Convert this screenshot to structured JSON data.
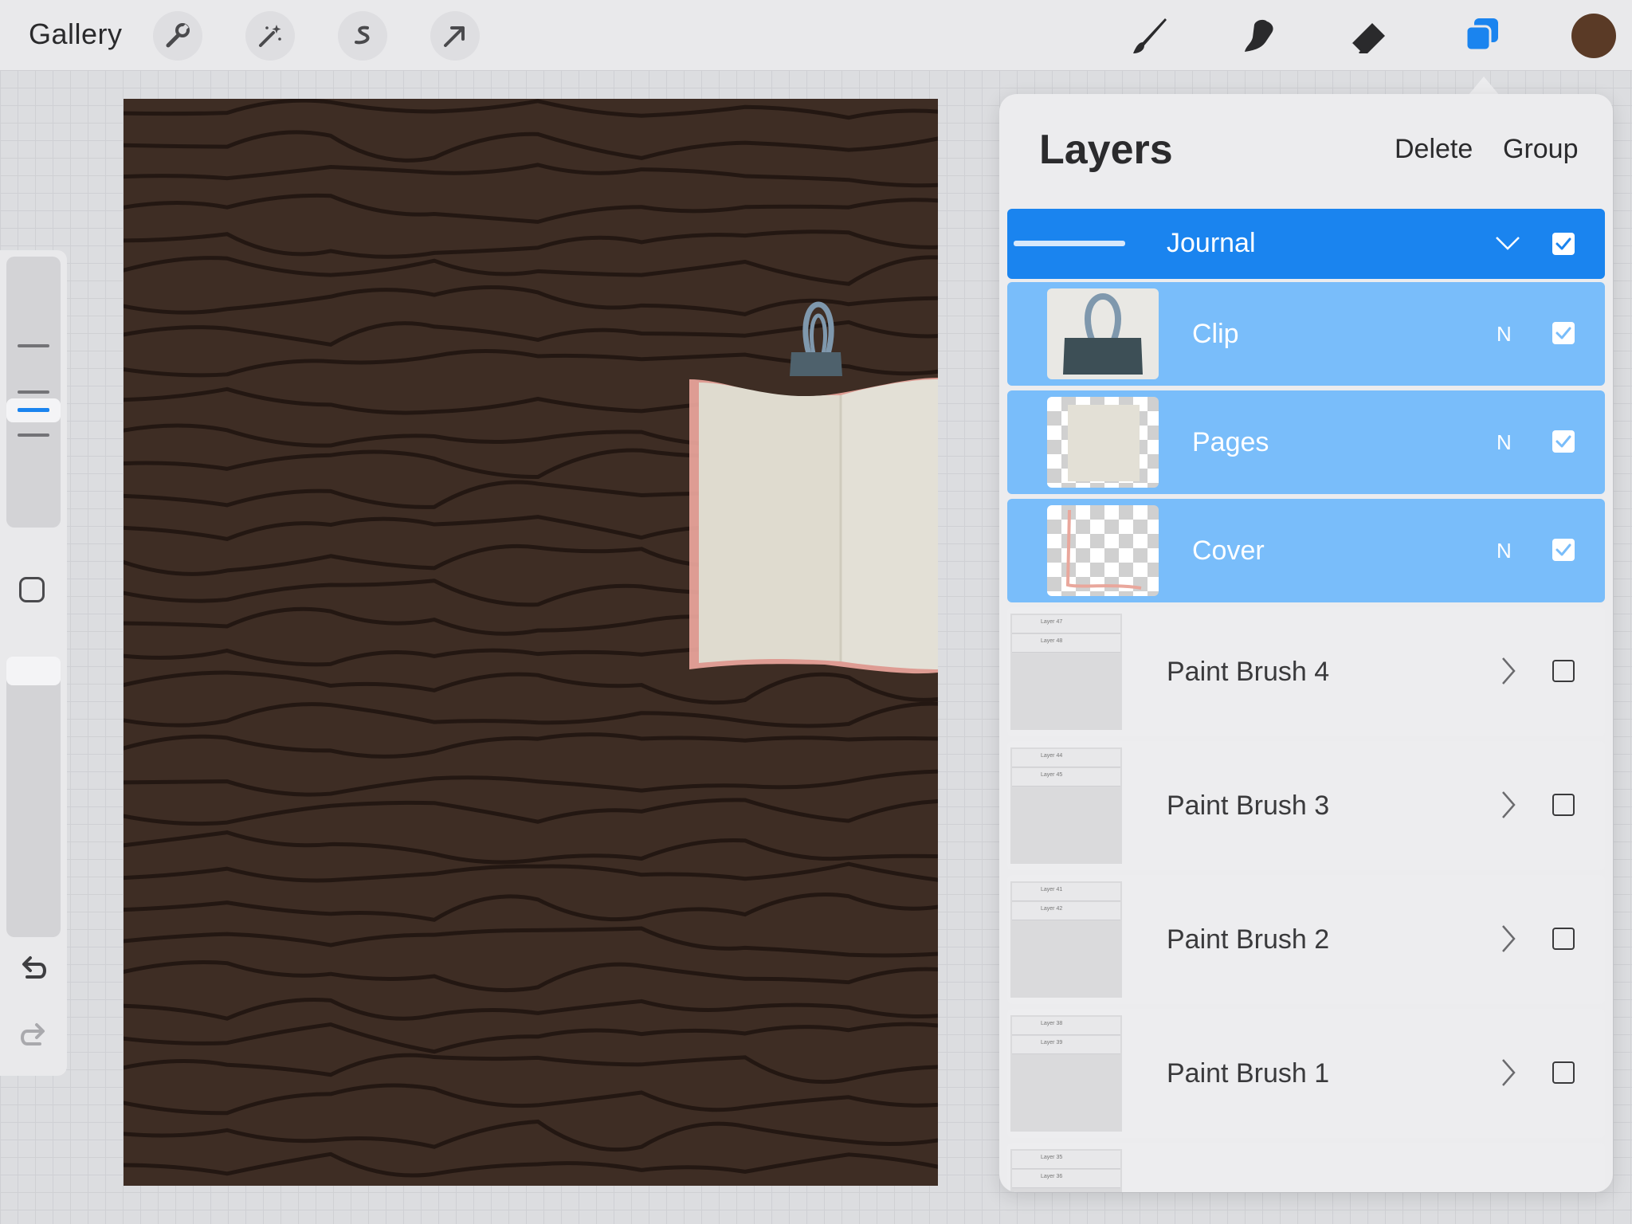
{
  "toolbar": {
    "gallery_label": "Gallery",
    "left_tools": [
      "wrench-icon",
      "magic-wand-icon",
      "selection-s-icon",
      "transform-arrow-icon"
    ],
    "right_tools": [
      "brush-icon",
      "smudge-icon",
      "eraser-icon",
      "layers-icon"
    ],
    "current_color": "#5a3a26",
    "accent_color": "#1a84ef"
  },
  "sidebar": {
    "tools": [
      "brush-size-slider",
      "modify-button",
      "opacity-slider",
      "undo-icon",
      "redo-icon"
    ]
  },
  "layers_panel": {
    "title": "Layers",
    "delete_label": "Delete",
    "group_label": "Group",
    "group": {
      "name": "Journal",
      "expanded": true,
      "visible": true,
      "selected": true
    },
    "sublayers": [
      {
        "name": "Clip",
        "blend": "N",
        "visible": true
      },
      {
        "name": "Pages",
        "blend": "N",
        "visible": true
      },
      {
        "name": "Cover",
        "blend": "N",
        "visible": true
      }
    ],
    "groups": [
      {
        "name": "Paint Brush 4",
        "visible": false,
        "thumb_rows": [
          "Layer 47",
          "Layer 48"
        ]
      },
      {
        "name": "Paint Brush 3",
        "visible": false,
        "thumb_rows": [
          "Layer 44",
          "Layer 45"
        ]
      },
      {
        "name": "Paint Brush 2",
        "visible": false,
        "thumb_rows": [
          "Layer 41",
          "Layer 42"
        ]
      },
      {
        "name": "Paint Brush 1",
        "visible": false,
        "thumb_rows": [
          "Layer 38",
          "Layer 39"
        ]
      }
    ],
    "partial_row_thumb": [
      "Layer 35",
      "Layer 36"
    ]
  }
}
